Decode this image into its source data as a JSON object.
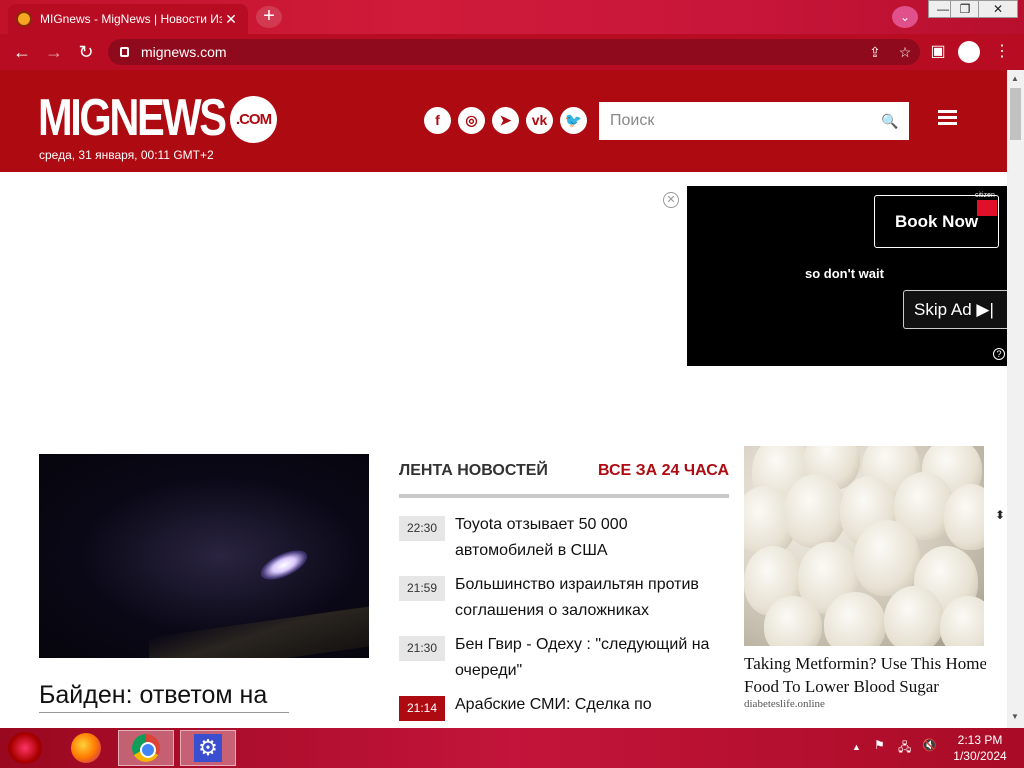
{
  "browser": {
    "tab_title": "MIGnews - MigNews | Новости Израиля",
    "tab_close": "✕",
    "new_tab": "+",
    "tab_search": "⌄",
    "url": "mignews.com",
    "win_min": "—",
    "win_restore": "❐",
    "win_close": "✕",
    "back": "←",
    "forward": "→",
    "reload": "↻",
    "share": "⇪",
    "star": "☆",
    "side_panel": "▣",
    "menu": "⋮"
  },
  "site": {
    "logo": "MIGNEWS",
    "logo_com": ".COM",
    "date": "среда, 31 января, 00:11 GMT+2",
    "socials": [
      {
        "icon": "facebook-icon",
        "glyph": "f"
      },
      {
        "icon": "instagram-icon",
        "glyph": "◎"
      },
      {
        "icon": "telegram-icon",
        "glyph": "➤"
      },
      {
        "icon": "vk-icon",
        "glyph": "vk"
      },
      {
        "icon": "twitter-icon",
        "glyph": "🐦"
      }
    ],
    "search_placeholder": "Поиск",
    "search_glyph": "🔍"
  },
  "ad": {
    "close": "✕",
    "book_now": "Book Now",
    "brand": "citizen",
    "text": "so don't wait",
    "skip": "Skip Ad ▶|",
    "help": "?"
  },
  "main": {
    "hero_title": "Байден: ответом на",
    "feed_label": "ЛЕНТА НОВОСТЕЙ",
    "feed_all": "ВСЕ ЗА 24 ЧАСА",
    "feed": [
      {
        "time": "22:30",
        "text": "Toyota отзывает 50 000 автомобилей в США",
        "hot": false
      },
      {
        "time": "21:59",
        "text": "Большинство израильтян против соглашения о заложниках",
        "hot": false
      },
      {
        "time": "21:30",
        "text": "Бен Гвир  - Одеху : \"следующий на очереди\"",
        "hot": false
      },
      {
        "time": "21:14",
        "text": "Арабские СМИ: Сделка по",
        "hot": true
      }
    ],
    "side_title_1": "Taking Metformin? Use This Home",
    "side_title_2": "Food To Lower Blood Sugar",
    "side_source": "diabeteslife.online"
  },
  "taskbar": {
    "clock_time": "2:13 PM",
    "clock_date": "1/30/2024",
    "tray_up": "▲",
    "tray_flag": "⚑",
    "tray_network": "🖧",
    "tray_volume": "🔇"
  },
  "colors": {
    "brand_red": "#ad0a12",
    "browser_red": "#b70c22"
  }
}
